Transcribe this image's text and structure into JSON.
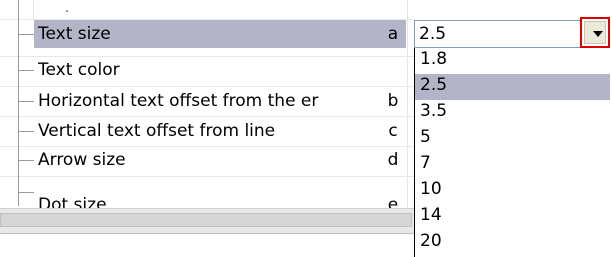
{
  "properties": [
    {
      "name": "Text size",
      "key": "a"
    },
    {
      "name": "Text color",
      "key": ""
    },
    {
      "name": "Horizontal text offset from the er",
      "key": "b"
    },
    {
      "name": "Vertical text offset from line",
      "key": "c"
    },
    {
      "name": "Arrow size",
      "key": "d"
    },
    {
      "name": "Dot size",
      "key": "e"
    }
  ],
  "selected_value": "2.5",
  "dropdown": {
    "options": [
      "1.8",
      "2.5",
      "3.5",
      "5",
      "7",
      "10",
      "14",
      "20"
    ],
    "selected_index": 1
  },
  "colors": {
    "selection": "#b4b4c8",
    "focus_outline": "#e00000"
  },
  "icons": {
    "dropdown": "chevron-down-icon"
  }
}
